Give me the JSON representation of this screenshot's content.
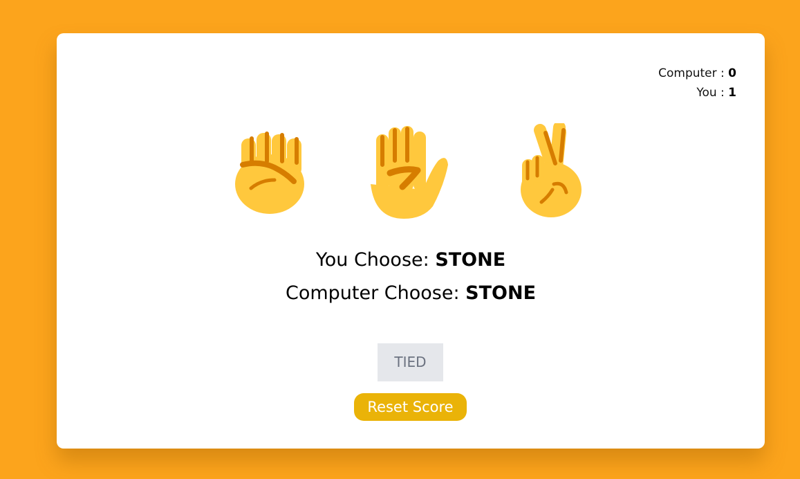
{
  "scoreboard": {
    "computer_label": "Computer : ",
    "computer_score": "0",
    "you_label": "You : ",
    "you_score": "1"
  },
  "choices": [
    {
      "name": "stone",
      "icon": "raised-fist-icon"
    },
    {
      "name": "paper",
      "icon": "raised-hand-icon"
    },
    {
      "name": "scissors",
      "icon": "victory-hand-icon"
    }
  ],
  "result": {
    "you_label": "You Choose: ",
    "you_choice": "STONE",
    "computer_label": "Computer Choose: ",
    "computer_choice": "STONE",
    "status": "TIED"
  },
  "reset_label": "Reset Score",
  "colors": {
    "background": "#fca41c",
    "card": "#ffffff",
    "emoji_skin": "#ffc83d",
    "emoji_shade": "#d67d00",
    "status_bg": "#e5e7eb",
    "status_text": "#6b7280",
    "reset_bg": "#eab308"
  }
}
